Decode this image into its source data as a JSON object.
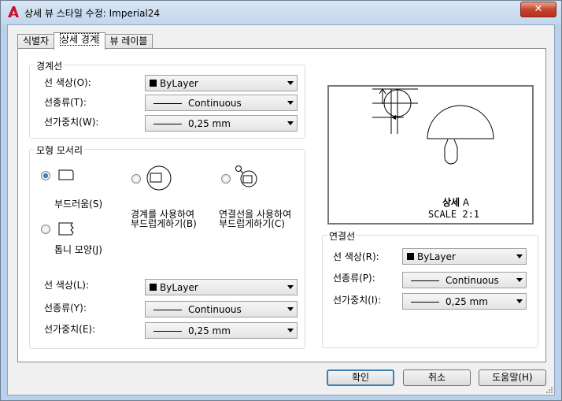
{
  "window": {
    "title": "상세 뷰 스타일 수정: Imperial24",
    "close": "✕"
  },
  "tabs": [
    "식별자",
    "상세 경계",
    "뷰 레이블"
  ],
  "boundary": {
    "title": "경계선",
    "color_label": "선 색상(O):",
    "color_value": "ByLayer",
    "linetype_label": "선종류(T):",
    "linetype_value": "Continuous",
    "lineweight_label": "선가중치(W):",
    "lineweight_value": "0,25 mm"
  },
  "model_edge": {
    "title": "모형 모서리",
    "opt_smooth": "부드러움(S)",
    "opt_smooth_border_1": "경계를 사용하여",
    "opt_smooth_border_2": "부드럽게하기(B)",
    "opt_smooth_conn_1": "연결선을 사용하여",
    "opt_smooth_conn_2": "부드럽게하기(C)",
    "opt_jagged": "톱니 모양(J)",
    "color_label": "선 색상(L):",
    "color_value": "ByLayer",
    "linetype_label": "선종류(Y):",
    "linetype_value": "Continuous",
    "lineweight_label": "선가중치(E):",
    "lineweight_value": "0,25 mm"
  },
  "preview": {
    "detail_bold": "상세",
    "detail_letter": "A",
    "scale": "SCALE 2:1"
  },
  "connection": {
    "title": "연결선",
    "color_label": "선 색상(R):",
    "color_value": "ByLayer",
    "linetype_label": "선종류(P):",
    "linetype_value": "Continuous",
    "lineweight_label": "선가중치(I):",
    "lineweight_value": "0,25 mm"
  },
  "buttons": {
    "ok": "확인",
    "cancel": "취소",
    "help": "도움말(H)"
  }
}
